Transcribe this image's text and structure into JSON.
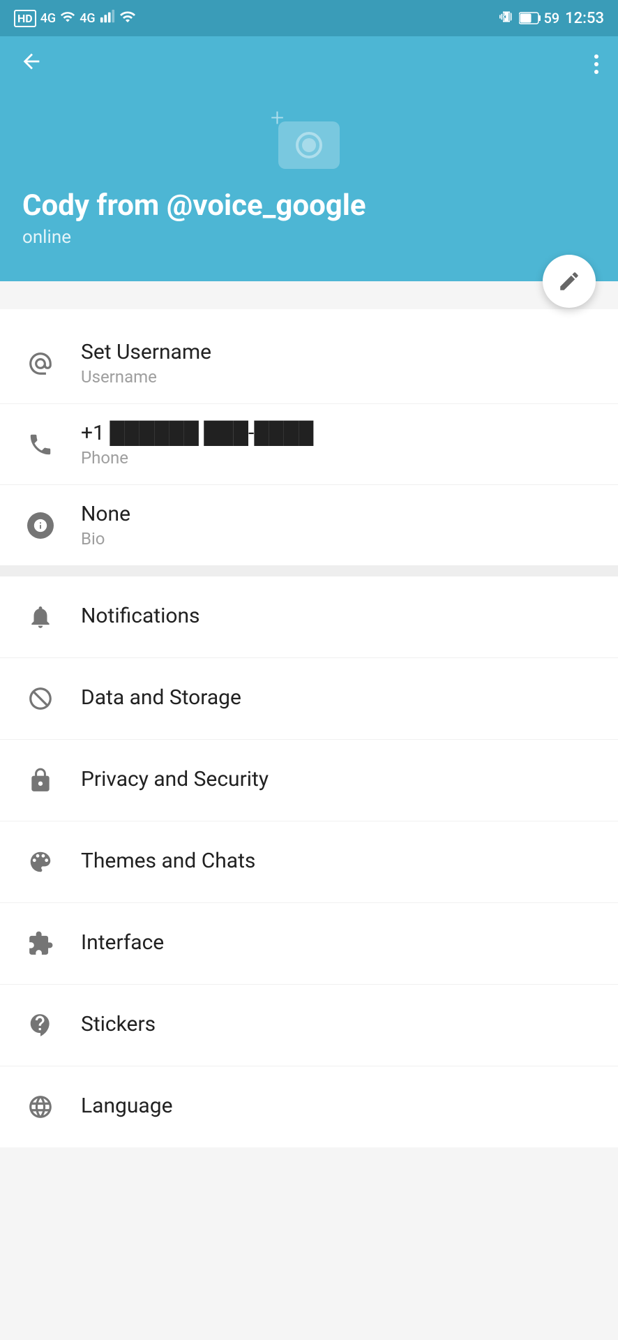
{
  "statusBar": {
    "leftIcons": [
      "HD",
      "4G",
      "signal1",
      "4G",
      "signal2",
      "wifi"
    ],
    "battery": "59",
    "time": "12:53"
  },
  "appBar": {
    "backLabel": "←",
    "menuLabel": "⋮"
  },
  "profile": {
    "name": "Cody from @voice_google",
    "status": "online",
    "editLabel": "edit",
    "cameraAlt": "Add photo"
  },
  "profileItems": [
    {
      "id": "username",
      "icon": "at-icon",
      "title": "Set Username",
      "subtitle": "Username"
    },
    {
      "id": "phone",
      "icon": "phone-icon",
      "title": "+1 ██████ ███-████",
      "subtitle": "Phone"
    },
    {
      "id": "bio",
      "icon": "info-icon",
      "title": "None",
      "subtitle": "Bio"
    }
  ],
  "menuItems": [
    {
      "id": "notifications",
      "icon": "bell-icon",
      "label": "Notifications"
    },
    {
      "id": "data-storage",
      "icon": "data-icon",
      "label": "Data and Storage"
    },
    {
      "id": "privacy-security",
      "icon": "lock-icon",
      "label": "Privacy and Security"
    },
    {
      "id": "themes-chats",
      "icon": "palette-icon",
      "label": "Themes and Chats"
    },
    {
      "id": "interface",
      "icon": "puzzle-icon",
      "label": "Interface"
    },
    {
      "id": "stickers",
      "icon": "sticker-icon",
      "label": "Stickers"
    },
    {
      "id": "language",
      "icon": "globe-icon",
      "label": "Language"
    }
  ],
  "colors": {
    "accent": "#4db6d4",
    "headerBg": "#4db6d4",
    "iconGray": "#757575",
    "divider": "#f0f0f0"
  }
}
